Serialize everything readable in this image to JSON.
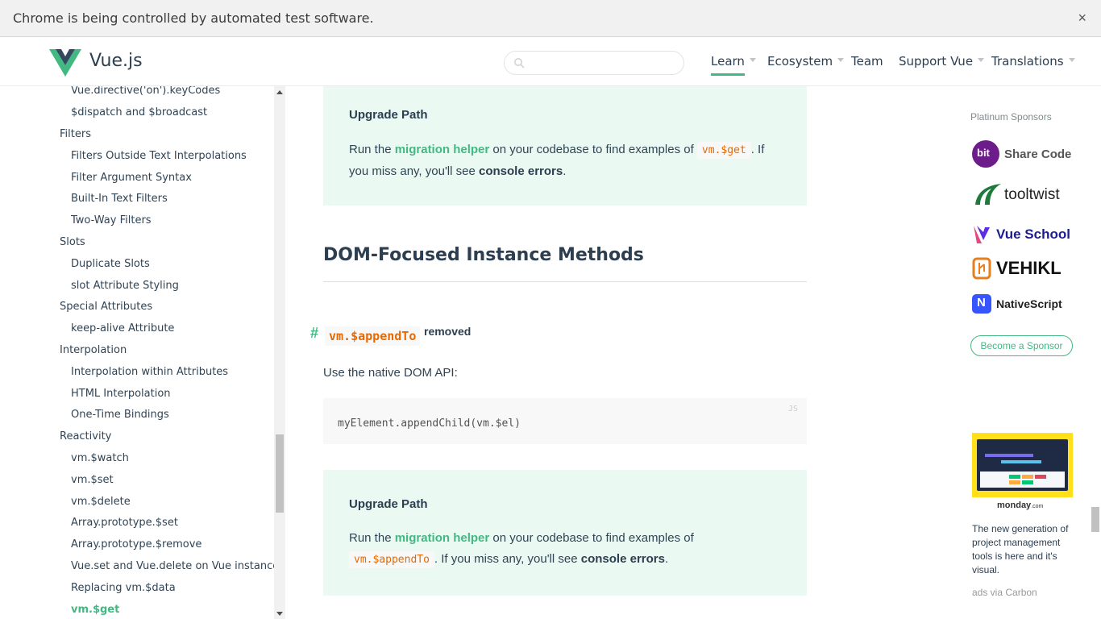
{
  "infobar": {
    "message": "Chrome is being controlled by automated test software.",
    "close": "×"
  },
  "header": {
    "brand": "Vue.js",
    "search_placeholder": "",
    "nav": [
      {
        "label": "Learn",
        "active": true,
        "dropdown": true
      },
      {
        "label": "Ecosystem",
        "dropdown": true
      },
      {
        "label": "Team",
        "dropdown": false
      },
      {
        "label": "Support Vue",
        "dropdown": true
      },
      {
        "label": "Translations",
        "dropdown": true
      }
    ]
  },
  "sidebar": {
    "items": [
      {
        "label": "Vue.directive('on').keyCodes",
        "level": 2
      },
      {
        "label": "$dispatch and $broadcast",
        "level": 2
      },
      {
        "label": "Filters",
        "level": 1
      },
      {
        "label": "Filters Outside Text Interpolations",
        "level": 2
      },
      {
        "label": "Filter Argument Syntax",
        "level": 2
      },
      {
        "label": "Built-In Text Filters",
        "level": 2
      },
      {
        "label": "Two-Way Filters",
        "level": 2
      },
      {
        "label": "Slots",
        "level": 1
      },
      {
        "label": "Duplicate Slots",
        "level": 2
      },
      {
        "label": "slot Attribute Styling",
        "level": 2
      },
      {
        "label": "Special Attributes",
        "level": 1
      },
      {
        "label": "keep-alive Attribute",
        "level": 2
      },
      {
        "label": "Interpolation",
        "level": 1
      },
      {
        "label": "Interpolation within Attributes",
        "level": 2
      },
      {
        "label": "HTML Interpolation",
        "level": 2
      },
      {
        "label": "One-Time Bindings",
        "level": 2
      },
      {
        "label": "Reactivity",
        "level": 1
      },
      {
        "label": "vm.$watch",
        "level": 2
      },
      {
        "label": "vm.$set",
        "level": 2
      },
      {
        "label": "vm.$delete",
        "level": 2
      },
      {
        "label": "Array.prototype.$set",
        "level": 2
      },
      {
        "label": "Array.prototype.$remove",
        "level": 2
      },
      {
        "label": "Vue.set and Vue.delete on Vue instances",
        "level": 2
      },
      {
        "label": "Replacing vm.$data",
        "level": 2
      },
      {
        "label": "vm.$get",
        "level": 2,
        "active": true
      }
    ]
  },
  "content": {
    "tip1": {
      "title": "Upgrade Path",
      "run": "Run the",
      "link": "migration helper",
      "mid": "on your codebase to find examples of",
      "code": "vm.$get",
      "tail": ". If you miss any, you'll see",
      "strong": "console errors",
      "end": "."
    },
    "section_title": "DOM-Focused Instance Methods",
    "anchor": "#",
    "method_code": "vm.$appendTo",
    "method_status": "removed",
    "paragraph": "Use the native DOM API:",
    "code_lang": "JS",
    "code_line": "myElement.appendChild(vm.$el)",
    "tip2": {
      "title": "Upgrade Path",
      "run": "Run the",
      "link": "migration helper",
      "mid": "on your codebase to find examples of",
      "code": "vm.$appendTo",
      "tail": ". If you miss any, you'll see",
      "strong": "console errors",
      "end": "."
    }
  },
  "sponsors": {
    "title": "Platinum Sponsors",
    "items": [
      {
        "name": "Share Code",
        "mark": "bit"
      },
      {
        "name": "tooltwist",
        "mark": ""
      },
      {
        "name": "Vue School",
        "mark": ""
      },
      {
        "name": "VEHIKL",
        "mark": ""
      },
      {
        "name": "NativeScript",
        "mark": "N"
      }
    ],
    "become": "Become a Sponsor"
  },
  "ad": {
    "brand": "monday",
    "brand_suffix": ".com",
    "text": "The new generation of project management tools is here and it's visual.",
    "via": "ads via Carbon"
  },
  "colors": {
    "accent": "#42b983",
    "code": "#e96900",
    "tip_bg": "#eafaf2",
    "text": "#2c3e50"
  }
}
